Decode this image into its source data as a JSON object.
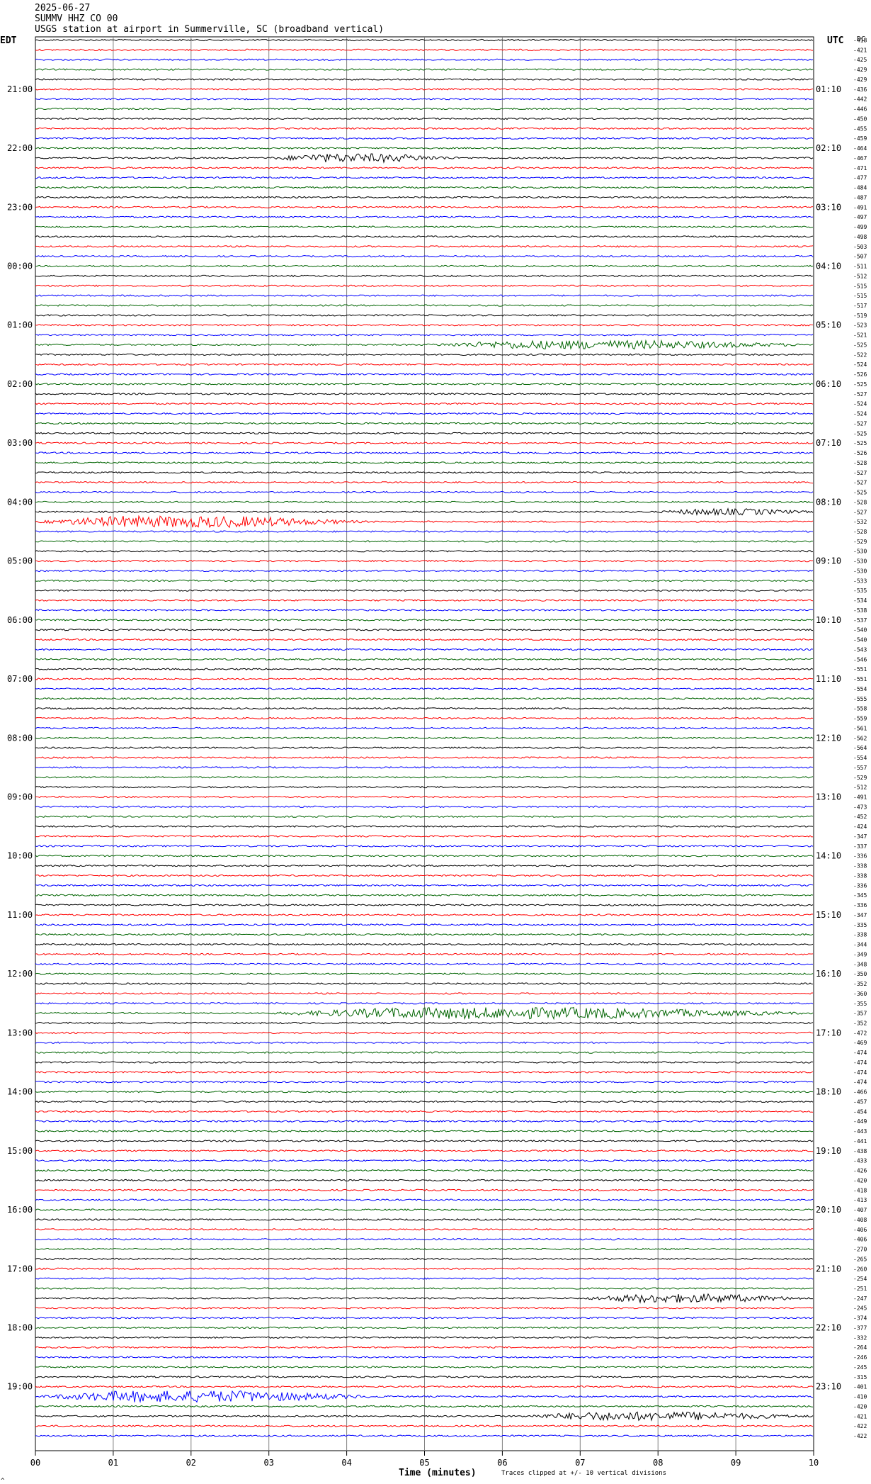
{
  "header": {
    "date": "2025-06-27",
    "station": "SUMMV HHZ CO 00",
    "description": "USGS station at airport in Summerville, SC (broadband vertical)"
  },
  "labels": {
    "left_zone": "EDT",
    "right_zone": "UTC",
    "dc": "DC",
    "footer_note": "Traces clipped at +/- 10 vertical divisions",
    "corner_mark": "^"
  },
  "colors": {
    "black": "#000000",
    "red": "#ff0000",
    "blue": "#0000ff",
    "green": "#006400",
    "grid": "#808080"
  },
  "chart_data": {
    "type": "line",
    "title": "",
    "xlabel": "Time (minutes)",
    "ylabel": "",
    "xlim": [
      0,
      10
    ],
    "x_ticks": [
      "00",
      "01",
      "02",
      "03",
      "04",
      "05",
      "06",
      "07",
      "08",
      "09",
      "10"
    ],
    "rows_per_hour": 6,
    "minutes_per_row": 10,
    "color_cycle": [
      "black",
      "red",
      "blue",
      "green"
    ],
    "edt_hour_labels": [
      "21:00",
      "22:00",
      "23:00",
      "00:00",
      "01:00",
      "02:00",
      "03:00",
      "04:00",
      "05:00",
      "06:00",
      "07:00",
      "08:00",
      "09:00",
      "10:00",
      "11:00",
      "12:00",
      "13:00",
      "14:00",
      "15:00",
      "16:00",
      "17:00",
      "18:00",
      "19:00"
    ],
    "utc_hour_labels": [
      "01:10",
      "02:10",
      "03:10",
      "04:10",
      "05:10",
      "06:10",
      "07:10",
      "08:10",
      "09:10",
      "10:10",
      "11:10",
      "12:10",
      "13:10",
      "14:10",
      "15:10",
      "16:10",
      "17:10",
      "18:10",
      "19:10",
      "20:10",
      "21:10",
      "22:10",
      "23:10"
    ],
    "dc_offsets": [
      418,
      421,
      425,
      429,
      429,
      436,
      442,
      446,
      450,
      455,
      459,
      464,
      467,
      471,
      477,
      484,
      487,
      491,
      497,
      499,
      498,
      503,
      507,
      511,
      512,
      515,
      515,
      517,
      519,
      523,
      521,
      525,
      522,
      524,
      526,
      525,
      527,
      524,
      524,
      527,
      525,
      525,
      526,
      528,
      527,
      527,
      525,
      528,
      527,
      532,
      528,
      529,
      530,
      530,
      530,
      533,
      535,
      534,
      538,
      537,
      540,
      540,
      543,
      546,
      551,
      551,
      554,
      555,
      558,
      559,
      561,
      562,
      564,
      554,
      557,
      529,
      512,
      491,
      473,
      452,
      424,
      347,
      337,
      336,
      338,
      338,
      336,
      345,
      336,
      347,
      335,
      338,
      344,
      349,
      348,
      350,
      352,
      360,
      355,
      357,
      352,
      472,
      469,
      474,
      474,
      474,
      474,
      466,
      457,
      454,
      449,
      443,
      441,
      438,
      433,
      426,
      420,
      418,
      413,
      407,
      408,
      406,
      406,
      270,
      265,
      260,
      254,
      251,
      247,
      245,
      374,
      377,
      332,
      264,
      246,
      245,
      315,
      401,
      410,
      420,
      421,
      422,
      422
    ],
    "events": [
      {
        "row": 12,
        "start_min": 3.0,
        "end_min": 5.5,
        "amplitude": "moderate"
      },
      {
        "row": 31,
        "start_min": 5.0,
        "end_min": 10.0,
        "amplitude": "moderate"
      },
      {
        "row": 48,
        "start_min": 8.0,
        "end_min": 10.0,
        "amplitude": "small"
      },
      {
        "row": 49,
        "start_min": 0.0,
        "end_min": 4.3,
        "amplitude": "large"
      },
      {
        "row": 99,
        "start_min": 3.0,
        "end_min": 10.0,
        "amplitude": "large"
      },
      {
        "row": 128,
        "start_min": 7.0,
        "end_min": 10.0,
        "amplitude": "moderate"
      },
      {
        "row": 138,
        "start_min": 0.0,
        "end_min": 4.5,
        "amplitude": "large"
      },
      {
        "row": 140,
        "start_min": 6.2,
        "end_min": 10.0,
        "amplitude": "moderate"
      }
    ]
  }
}
